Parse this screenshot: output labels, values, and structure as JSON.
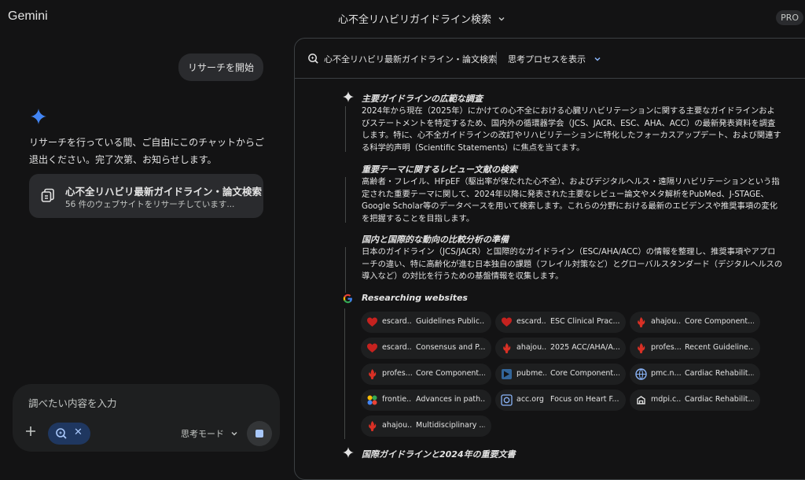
{
  "app": {
    "name": "Gemini",
    "plan_badge": "PRO"
  },
  "header": {
    "title": "心不全リハビリガイドライン検索"
  },
  "chat": {
    "user_message": "リサーチを開始",
    "ai_message": "リサーチを行っている間、ご自由にこのチャットからご退出ください。完了次第、お知らせします。",
    "task_card": {
      "title": "心不全リハビリ最新ガイドライン・論文検索",
      "subtitle": "56 件のウェブサイトをリサーチしています..."
    }
  },
  "composer": {
    "placeholder": "調べたい内容を入力",
    "mode_label": "思考モード"
  },
  "panel": {
    "title": "心不全リハビリ最新ガイドライン・論文検索",
    "toggle_label": "思考プロセスを表示",
    "steps": [
      {
        "title": "主要ガイドラインの広範な調査",
        "body": "2024年から現在（2025年）にかけての心不全における心臓リハビリテーションに関する主要なガイドラインおよびステートメントを特定するため、国内外の循環器学会（JCS、JACR、ESC、AHA、ACC）の最新発表資料を調査します。特に、心不全ガイドラインの改訂やリハビリテーションに特化したフォーカスアップデート、および関連する科学的声明（Scientific Statements）に焦点を当てます。"
      },
      {
        "title": "重要テーマに関するレビュー文献の検索",
        "body": "高齢者・フレイル、HFpEF（駆出率が保たれた心不全）、およびデジタルヘルス・遠隔リハビリテーションという指定された重要テーマに関して、2024年以降に発表された主要なレビュー論文やメタ解析をPubMed、J-STAGE、Google Scholar等のデータベースを用いて検索します。これらの分野における最新のエビデンスや推奨事項の変化を把握することを目指します。"
      },
      {
        "title": "国内と国際的な動向の比較分析の準備",
        "body": "日本のガイドライン（JCS/JACR）と国際的なガイドライン（ESC/AHA/ACC）の情報を整理し、推奨事項やアプローチの違い、特に高齢化が進む日本独自の課題（フレイル対策など）とグローバルスタンダード（デジタルヘルスの導入など）の対比を行うための基盤情報を収集します。"
      }
    ],
    "researching_label": "Researching websites",
    "sites": [
      {
        "source": "escard...",
        "title": "Guidelines Public...",
        "icon": "heart-icon",
        "color": "#c5221f"
      },
      {
        "source": "escard...",
        "title": "ESC Clinical Prac...",
        "icon": "heart-icon",
        "color": "#c5221f"
      },
      {
        "source": "ahajou...",
        "title": "Core Component...",
        "icon": "torch-icon",
        "color": "#d93025"
      },
      {
        "source": "escard...",
        "title": "Consensus and P...",
        "icon": "heart-icon",
        "color": "#c5221f"
      },
      {
        "source": "ahajou...",
        "title": "2025 ACC/AHA/A...",
        "icon": "torch-icon",
        "color": "#d93025"
      },
      {
        "source": "profes...",
        "title": "Recent Guideline...",
        "icon": "torch-icon",
        "color": "#d93025"
      },
      {
        "source": "profes...",
        "title": "Core Component...",
        "icon": "torch-icon",
        "color": "#d93025"
      },
      {
        "source": "pubme...",
        "title": "Core Component...",
        "icon": "pubmed-icon",
        "color": "#326599"
      },
      {
        "source": "pmc.n...",
        "title": "Cardiac Rehabilit...",
        "icon": "pmc-icon",
        "color": "#8ab4f8"
      },
      {
        "source": "frontie...",
        "title": "Advances in path...",
        "icon": "frontiers-icon",
        "color": "#f9ab00"
      },
      {
        "source": "acc.org",
        "title": "Focus on Heart F...",
        "icon": "acc-icon",
        "color": "#8ab4f8"
      },
      {
        "source": "mdpi.c...",
        "title": "Cardiac Rehabilit...",
        "icon": "mdpi-icon",
        "color": "#e3e3e3"
      },
      {
        "source": "ahajou...",
        "title": "Multidisciplinary ...",
        "icon": "torch-icon",
        "color": "#d93025"
      }
    ],
    "next_step_title": "国際ガイドラインと2024年の重要文書"
  },
  "colors": {
    "background": "#131314",
    "surface": "#1e1f20",
    "chip": "#1f3760",
    "accent": "#a8c7fa",
    "spark_blue": "#4285f4"
  }
}
